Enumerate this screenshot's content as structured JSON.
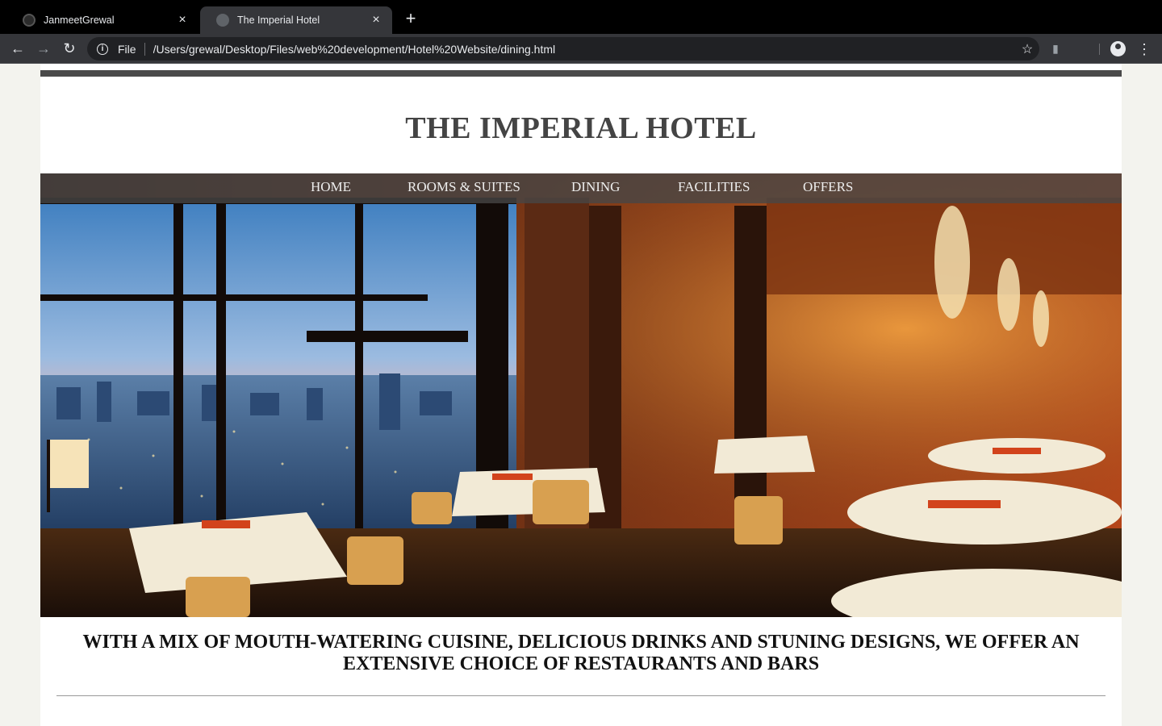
{
  "browser": {
    "tabs": [
      {
        "title": "JanmeetGrewal",
        "favicon": "github-icon",
        "active": false
      },
      {
        "title": "The Imperial Hotel",
        "favicon": "globe-icon",
        "active": true
      }
    ],
    "address": {
      "scheme_label": "File",
      "url": "/Users/grewal/Desktop/Files/web%20development/Hotel%20Website/dining.html"
    }
  },
  "site": {
    "title": "THE IMPERIAL HOTEL",
    "nav": [
      "HOME",
      "ROOMS & SUITES",
      "DINING",
      "FACILITIES",
      "OFFERS"
    ],
    "hero_image": "restaurant-with-city-view",
    "tagline": "WITH A MIX OF MOUTH-WATERING CUISINE, DELICIOUS DRINKS AND STUNING DESIGNS, WE OFFER AN EXTENSIVE CHOICE OF RESTAURANTS AND BARS"
  },
  "colors": {
    "chrome_dark": "#35363a",
    "tabstrip": "#000000",
    "page_bg": "#f3f3ee",
    "title_text": "#444444",
    "nav_bar": "#464646"
  }
}
